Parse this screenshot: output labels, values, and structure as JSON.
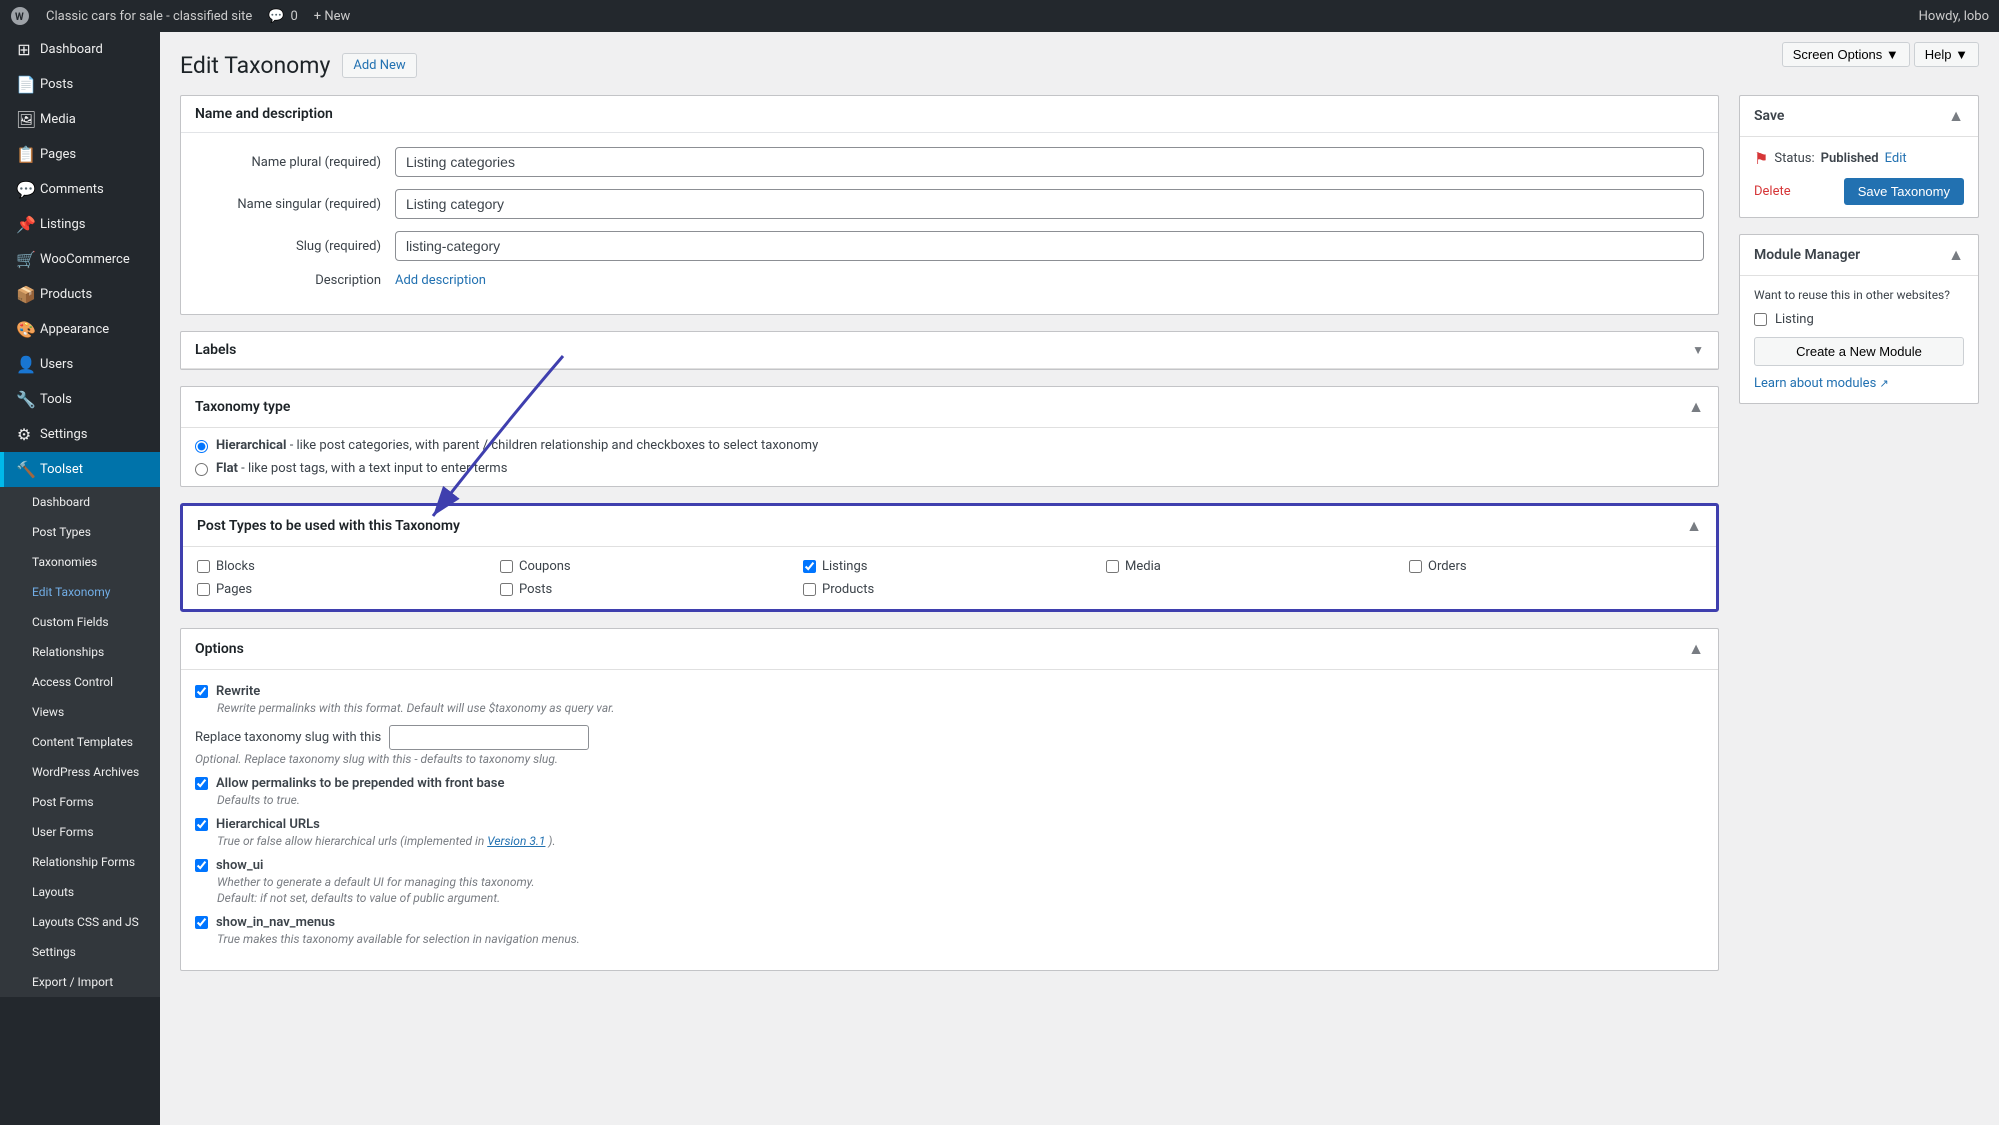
{
  "adminbar": {
    "site_name": "Classic cars for sale - classified site",
    "comments_count": "0",
    "new_label": "+ New",
    "howdy": "Howdy, lobo"
  },
  "sidebar": {
    "items": [
      {
        "id": "dashboard",
        "label": "Dashboard",
        "icon": "⊞"
      },
      {
        "id": "posts",
        "label": "Posts",
        "icon": "📄"
      },
      {
        "id": "media",
        "label": "Media",
        "icon": "🖼"
      },
      {
        "id": "pages",
        "label": "Pages",
        "icon": "📋"
      },
      {
        "id": "comments",
        "label": "Comments",
        "icon": "💬"
      },
      {
        "id": "listings",
        "label": "Listings",
        "icon": "📌"
      },
      {
        "id": "woocommerce",
        "label": "WooCommerce",
        "icon": "🛒"
      },
      {
        "id": "products",
        "label": "Products",
        "icon": "📦"
      },
      {
        "id": "appearance",
        "label": "Appearance",
        "icon": "🎨"
      },
      {
        "id": "users",
        "label": "Users",
        "icon": "👤"
      },
      {
        "id": "tools",
        "label": "Tools",
        "icon": "🔧"
      },
      {
        "id": "settings",
        "label": "Settings",
        "icon": "⚙"
      },
      {
        "id": "toolset",
        "label": "Toolset",
        "icon": "🔨",
        "active": true
      }
    ],
    "toolset_submenu": [
      {
        "id": "ts-dashboard",
        "label": "Dashboard"
      },
      {
        "id": "post-types",
        "label": "Post Types"
      },
      {
        "id": "taxonomies",
        "label": "Taxonomies"
      },
      {
        "id": "edit-taxonomy",
        "label": "Edit Taxonomy",
        "active": true
      },
      {
        "id": "custom-fields",
        "label": "Custom Fields"
      },
      {
        "id": "relationships",
        "label": "Relationships"
      },
      {
        "id": "access-control",
        "label": "Access Control"
      },
      {
        "id": "views",
        "label": "Views"
      },
      {
        "id": "content-templates",
        "label": "Content Templates"
      },
      {
        "id": "wordpress-archives",
        "label": "WordPress Archives"
      },
      {
        "id": "post-forms",
        "label": "Post Forms"
      },
      {
        "id": "user-forms",
        "label": "User Forms"
      },
      {
        "id": "relationship-forms",
        "label": "Relationship Forms"
      },
      {
        "id": "layouts",
        "label": "Layouts"
      },
      {
        "id": "layouts-css-js",
        "label": "Layouts CSS and JS"
      },
      {
        "id": "ts-settings",
        "label": "Settings"
      },
      {
        "id": "export-import",
        "label": "Export / Import"
      }
    ]
  },
  "page": {
    "title": "Edit Taxonomy",
    "add_new_label": "Add New",
    "screen_options_label": "Screen Options ▼",
    "help_label": "Help ▼"
  },
  "name_description": {
    "section_title": "Name and description",
    "name_plural_label": "Name plural (required)",
    "name_plural_value": "Listing categories",
    "name_singular_label": "Name singular (required)",
    "name_singular_value": "Listing category",
    "slug_label": "Slug (required)",
    "slug_value": "listing-category",
    "description_label": "Description",
    "add_description_text": "Add description"
  },
  "labels": {
    "section_title": "Labels",
    "collapsed": true
  },
  "taxonomy_type": {
    "section_title": "Taxonomy type",
    "options": [
      {
        "id": "hierarchical",
        "value": "hierarchical",
        "label": "Hierarchical",
        "description": "- like post categories, with parent / children relationship and checkboxes to select taxonomy",
        "checked": true
      },
      {
        "id": "flat",
        "value": "flat",
        "label": "Flat",
        "description": "- like post tags, with a text input to enter terms",
        "checked": false
      }
    ]
  },
  "post_types": {
    "section_title": "Post Types to be used with this Taxonomy",
    "items": [
      {
        "id": "blocks",
        "label": "Blocks",
        "checked": false
      },
      {
        "id": "coupons",
        "label": "Coupons",
        "checked": false
      },
      {
        "id": "listings",
        "label": "Listings",
        "checked": true
      },
      {
        "id": "media",
        "label": "Media",
        "checked": false
      },
      {
        "id": "orders",
        "label": "Orders",
        "checked": false
      },
      {
        "id": "pages",
        "label": "Pages",
        "checked": false
      },
      {
        "id": "posts",
        "label": "Posts",
        "checked": false
      },
      {
        "id": "products",
        "label": "Products",
        "checked": false
      }
    ]
  },
  "options": {
    "section_title": "Options",
    "rewrite_label": "Rewrite",
    "rewrite_checked": true,
    "rewrite_desc": "Rewrite permalinks with this format. Default will use $taxonomy as query var.",
    "replace_slug_label": "Replace taxonomy slug with this",
    "replace_slug_placeholder": "",
    "replace_slug_desc": "Optional. Replace taxonomy slug with this - defaults to taxonomy slug.",
    "allow_permalinks_label": "Allow permalinks to be prepended with front base",
    "allow_permalinks_checked": true,
    "allow_permalinks_desc": "Defaults to true.",
    "hierarchical_urls_label": "Hierarchical URLs",
    "hierarchical_urls_checked": true,
    "hierarchical_urls_desc": "True or false allow hierarchical urls (implemented in ",
    "hierarchical_urls_link_text": "Version 3.1",
    "hierarchical_urls_suffix": ").",
    "show_ui_label": "show_ui",
    "show_ui_checked": true,
    "show_ui_desc": "Whether to generate a default UI for managing this taxonomy.",
    "show_ui_desc2": "Default: if not set, defaults to value of public argument.",
    "show_in_nav_label": "show_in_nav_menus",
    "show_in_nav_checked": true,
    "show_in_nav_desc": "True makes this taxonomy available for selection in navigation menus."
  },
  "save_panel": {
    "title": "Save",
    "status_label": "Status:",
    "status_value": "Published",
    "edit_label": "Edit",
    "delete_label": "Delete",
    "save_label": "Save Taxonomy"
  },
  "module_manager": {
    "title": "Module Manager",
    "description": "Want to reuse this in other websites?",
    "listing_label": "Listing",
    "create_btn_label": "Create a New Module",
    "learn_label": "Learn about modules"
  }
}
